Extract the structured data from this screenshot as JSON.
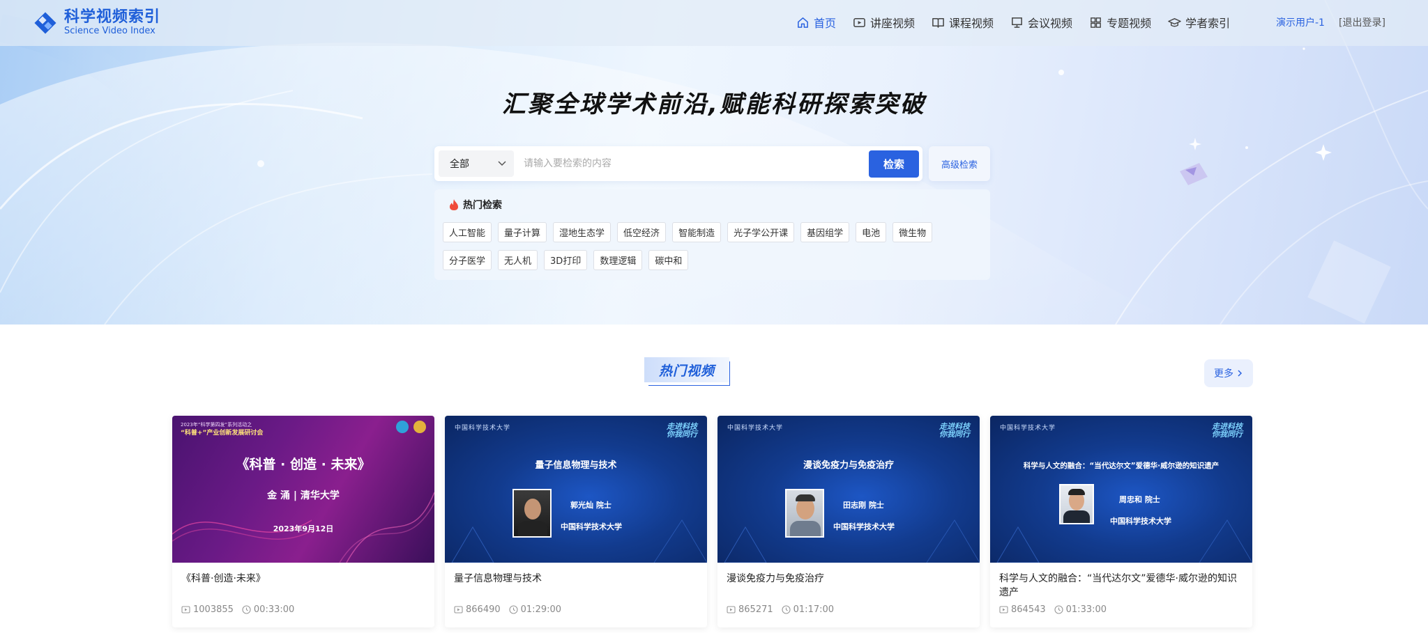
{
  "header": {
    "logo_cn": "科学视频索引",
    "logo_en": "Science Video Index",
    "nav": [
      {
        "label": "首页",
        "icon": "home-icon",
        "active": true
      },
      {
        "label": "讲座视频",
        "icon": "play-video-icon"
      },
      {
        "label": "课程视频",
        "icon": "book-icon"
      },
      {
        "label": "会议视频",
        "icon": "presentation-icon"
      },
      {
        "label": "专题视频",
        "icon": "grid-icon"
      },
      {
        "label": "学者索引",
        "icon": "graduation-cap-icon"
      }
    ],
    "user": "演示用户-1",
    "logout": "[退出登录]"
  },
  "hero": {
    "slogan": "汇聚全球学术前沿,赋能科研探索突破"
  },
  "search": {
    "scope": "全部",
    "placeholder": "请输入要检索的内容",
    "button": "检索",
    "advanced": "高级检索"
  },
  "hot_search": {
    "title": "热门检索",
    "row1": [
      "人工智能",
      "量子计算",
      "湿地生态学",
      "低空经济",
      "智能制造",
      "光子学公开课",
      "基因组学",
      "电池",
      "微生物"
    ],
    "row2": [
      "分子医学",
      "无人机",
      "3D打印",
      "数理逻辑",
      "碳中和"
    ]
  },
  "hot_videos": {
    "title": "热门视频",
    "more": "更多",
    "cards": [
      {
        "title": "《科普·创造·未来》",
        "views": "1003855",
        "duration": "00:33:00",
        "thumb": {
          "top_line1": "2023年“科学第四发”系列活动之",
          "top_line2": "“科普+”产业创新发展研讨会",
          "main": "《科普 · 创造 · 未来》",
          "speaker": "金  涌 | 清华大学",
          "date": "2023年9月12日"
        }
      },
      {
        "title": "量子信息物理与技术",
        "views": "866490",
        "duration": "01:29:00",
        "thumb": {
          "school": "中国科学技术大学",
          "badge_line1": "走进科技",
          "badge_line2": "你我同行",
          "main": "量子信息物理与技术",
          "name": "郭光灿  院士",
          "org": "中国科学技术大学"
        }
      },
      {
        "title": "漫谈免疫力与免疫治疗",
        "views": "865271",
        "duration": "01:17:00",
        "thumb": {
          "school": "中国科学技术大学",
          "badge_line1": "走进科技",
          "badge_line2": "你我同行",
          "main": "漫谈免疫力与免疫治疗",
          "name": "田志刚  院士",
          "org": "中国科学技术大学"
        }
      },
      {
        "title": "科学与人文的融合：“当代达尔文”爱德华·威尔逊的知识遗产",
        "views": "864543",
        "duration": "01:33:00",
        "thumb": {
          "school": "中国科学技术大学",
          "badge_line1": "走进科技",
          "badge_line2": "你我同行",
          "main": "科学与人文的融合：“当代达尔文”爱德华·威尔逊的知识遗产",
          "name": "周忠和  院士",
          "org": "中国科学技术大学"
        }
      }
    ]
  },
  "colors": {
    "accent": "#2a62e0",
    "hot_icon": "#f04b3a"
  }
}
